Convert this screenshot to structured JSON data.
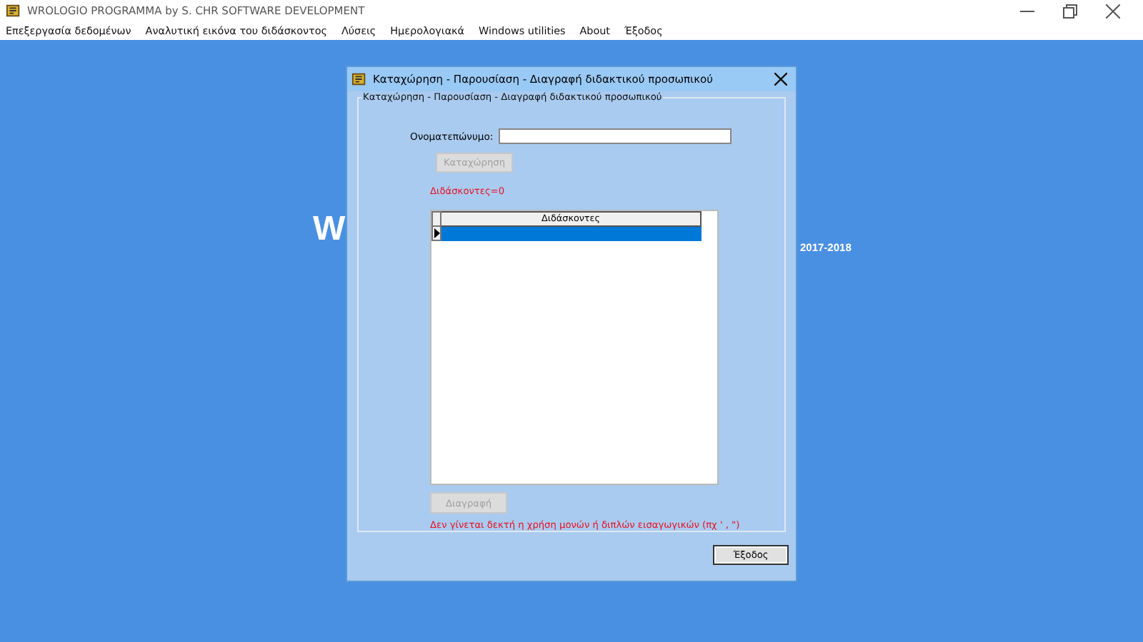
{
  "window": {
    "title": "WROLOGIO PROGRAMMA by S. CHR SOFTWARE DEVELOPMENT"
  },
  "menu": [
    "Επεξεργασία δεδομένων",
    "Αναλυτική εικόνα του διδάσκοντος",
    "Λύσεις",
    "Ημερολογιακά",
    "Windows utilities",
    "About",
    "Έξοδος"
  ],
  "background": {
    "heading": "W",
    "year": "2017-2018"
  },
  "dialog": {
    "title": "Καταχώρηση - Παρουσίαση - Διαγραφή διδακτικού προσωπικού",
    "group_title": "Καταχώρηση - Παρουσίαση - Διαγραφή διδακτικού προσωπικού",
    "name_label": "Ονοματεπώνυμο:",
    "add_button": {
      "label": "Καταχώρηση",
      "disabled": true
    },
    "count": "Διδάσκοντες=0",
    "grid": {
      "column": "Διδάσκοντες",
      "rows": [
        {
          "selected": true
        }
      ]
    },
    "delete_button": {
      "label": "Διαγραφή",
      "disabled": true
    },
    "warning": "Δεν γίνεται δεκτή η χρήση μονών ή διπλών εισαγωγικών (πχ ' , \")",
    "exit_button": {
      "label": "Έξοδος",
      "disabled": false
    }
  }
}
